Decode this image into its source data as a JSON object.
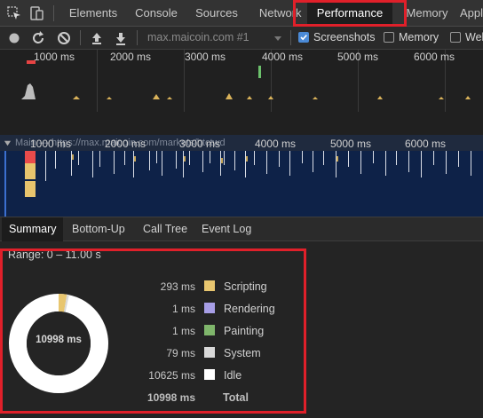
{
  "tabs": {
    "items": [
      "Elements",
      "Console",
      "Sources",
      "Network",
      "Performance",
      "Memory",
      "Appl"
    ],
    "active": "Performance"
  },
  "toolbar": {
    "url": "max.maicoin.com #1",
    "screenshots_label": "Screenshots",
    "screenshots_checked": true,
    "memory_label": "Memory",
    "memory_checked": false,
    "web_label": "Web"
  },
  "overview": {
    "ticks": [
      "1000 ms",
      "2000 ms",
      "3000 ms",
      "4000 ms",
      "5000 ms",
      "6000 ms"
    ]
  },
  "flame": {
    "ticks": [
      "1000 ms",
      "2000 ms",
      "3000 ms",
      "4000 ms",
      "5000 ms",
      "6000 ms"
    ],
    "track_label": "Main — https://max.maicoin.com/markets/btctwd"
  },
  "bottom_tabs": {
    "items": [
      "Summary",
      "Bottom-Up",
      "Call Tree",
      "Event Log"
    ],
    "active": "Summary"
  },
  "summary": {
    "range": "Range: 0 – 11.00 s",
    "total_center": "10998 ms",
    "rows": [
      {
        "value": "293 ms",
        "label": "Scripting",
        "color": "#e8c66f",
        "ms": 293
      },
      {
        "value": "1 ms",
        "label": "Rendering",
        "color": "#a79ee6",
        "ms": 1
      },
      {
        "value": "1 ms",
        "label": "Painting",
        "color": "#7fb66b",
        "ms": 1
      },
      {
        "value": "79 ms",
        "label": "System",
        "color": "#d9d9d9",
        "ms": 79
      },
      {
        "value": "10625 ms",
        "label": "Idle",
        "color": "#ffffff",
        "ms": 10625
      }
    ],
    "total_value": "10998 ms",
    "total_label": "Total"
  },
  "colors": {
    "highlight": "#e0202a",
    "flame_bg": "#0e2248",
    "checkbox_accent": "#4b8ad6"
  }
}
